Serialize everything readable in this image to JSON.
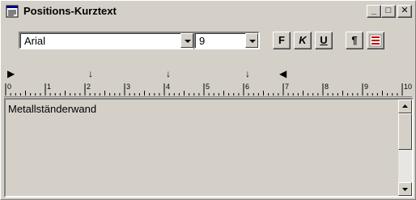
{
  "window": {
    "title": "Positions-Kurztext",
    "controls": {
      "minimize": "_",
      "maximize": "□",
      "close": "✕"
    }
  },
  "toolbar": {
    "font_name": "Arial",
    "font_size": "9",
    "bold_label": "F",
    "italic_label": "K",
    "underline_label": "U",
    "paragraph_label": "¶"
  },
  "ruler": {
    "numbers": [
      "0",
      "1",
      "2",
      "3",
      "4",
      "5",
      "6",
      "7",
      "8",
      "9",
      "10"
    ]
  },
  "editor": {
    "text": "Metallständerwand"
  },
  "icons": {
    "app": "document-list-icon",
    "tab_left": "left-tab-stop-icon",
    "indent_right": "right-indent-marker-icon",
    "indent_left": "left-indent-marker-icon"
  }
}
